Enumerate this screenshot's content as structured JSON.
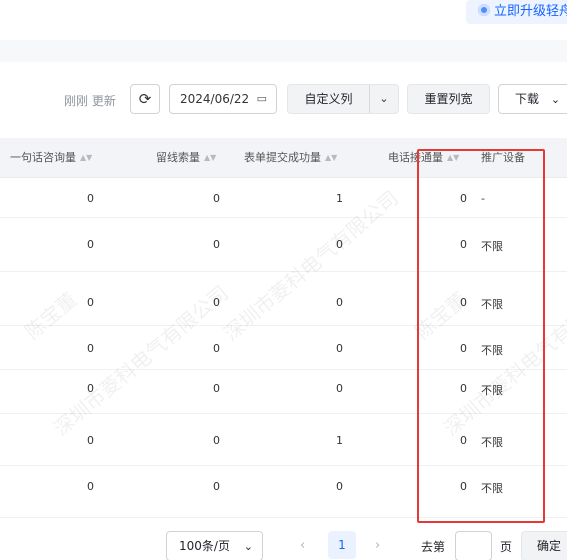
{
  "header": {
    "upgrade_label": "立即升级轻舟"
  },
  "toolbar": {
    "updated_text": "刚刚 更新",
    "date_value": "2024/06/22",
    "custom_columns_label": "自定义列",
    "reset_columns_label": "重置列宽",
    "download_label": "下载"
  },
  "table": {
    "columns": [
      {
        "label": "一句话咨询量"
      },
      {
        "label": "留线索量"
      },
      {
        "label": "表单提交成功量"
      },
      {
        "label": "电话接通量"
      },
      {
        "label": "推广设备"
      }
    ],
    "rows": [
      {
        "c1": "0",
        "c2": "0",
        "c3": "1",
        "c4": "0",
        "c5": "-"
      },
      {
        "c1": "0",
        "c2": "0",
        "c3": "0",
        "c4": "0",
        "c5": "不限"
      },
      {
        "c1": "0",
        "c2": "0",
        "c3": "0",
        "c4": "0",
        "c5": "不限"
      },
      {
        "c1": "0",
        "c2": "0",
        "c3": "0",
        "c4": "0",
        "c5": "不限"
      },
      {
        "c1": "0",
        "c2": "0",
        "c3": "0",
        "c4": "0",
        "c5": "不限"
      },
      {
        "c1": "0",
        "c2": "0",
        "c3": "1",
        "c4": "0",
        "c5": "不限"
      },
      {
        "c1": "0",
        "c2": "0",
        "c3": "0",
        "c4": "0",
        "c5": "不限"
      }
    ]
  },
  "watermark": {
    "line1": "陈宝董",
    "line2": "深圳市菱科电气有限公司"
  },
  "pagination": {
    "page_size": "100条/页",
    "current_page": "1",
    "goto_label": "去第",
    "page_unit": "页",
    "confirm_label": "确定"
  },
  "icons": {
    "refresh": "refresh-icon",
    "calendar": "calendar-icon",
    "chevron": "chevron-down-icon",
    "sort": "sort-icon"
  },
  "colors": {
    "accent": "#1664ff",
    "highlight_border": "#e53935",
    "header_bg": "#f2f4f7"
  }
}
